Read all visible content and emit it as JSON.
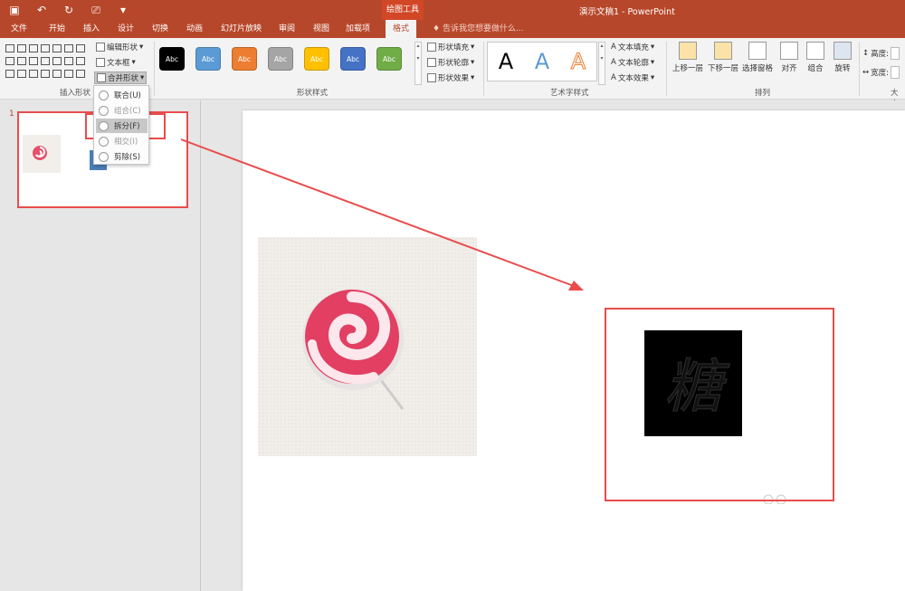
{
  "window": {
    "title": "演示文稿1 - PowerPoint",
    "context_tab_label": "绘图工具"
  },
  "quick_access": {
    "save_icon": "save-icon",
    "undo_icon": "undo-icon",
    "redo_icon": "redo-icon",
    "present_icon": "present-icon",
    "customize_icon": "customize-icon"
  },
  "tabs": [
    {
      "label": "文件"
    },
    {
      "label": "开始"
    },
    {
      "label": "插入"
    },
    {
      "label": "设计"
    },
    {
      "label": "切换"
    },
    {
      "label": "动画"
    },
    {
      "label": "幻灯片放映"
    },
    {
      "label": "审阅"
    },
    {
      "label": "视图"
    },
    {
      "label": "加载项"
    },
    {
      "label": "格式"
    }
  ],
  "tell_me": "告诉我您想要做什么...",
  "ribbon": {
    "insert_shapes": {
      "label": "插入形状",
      "edit_shape": "编辑形状",
      "text_box": "文本框",
      "merge_shapes": "合并形状"
    },
    "shape_styles": {
      "label": "形状样式",
      "swatches": [
        {
          "text": "Abc",
          "color": "#000000"
        },
        {
          "text": "Abc",
          "color": "#5b9bd5"
        },
        {
          "text": "Abc",
          "color": "#ed7d31"
        },
        {
          "text": "Abc",
          "color": "#a5a5a5"
        },
        {
          "text": "Abc",
          "color": "#ffc000"
        },
        {
          "text": "Abc",
          "color": "#4472c4"
        },
        {
          "text": "Abc",
          "color": "#70ad47"
        }
      ],
      "fill": "形状填充",
      "outline": "形状轮廓",
      "effects": "形状效果"
    },
    "wordart": {
      "label": "艺术字样式",
      "samples": [
        {
          "text": "A",
          "color": "#000000"
        },
        {
          "text": "A",
          "color": "#5b9bd5"
        },
        {
          "text": "A",
          "color": "#f4b183"
        }
      ],
      "text_fill": "文本填充",
      "text_outline": "文本轮廓",
      "text_effects": "文本效果"
    },
    "arrange": {
      "label": "排列",
      "bring_forward": "上移一层",
      "send_backward": "下移一层",
      "selection_pane": "选择窗格",
      "align": "对齐",
      "group": "组合",
      "rotate": "旋转"
    },
    "size": {
      "label": "大小",
      "height": "高度:",
      "width": "宽度:"
    }
  },
  "merge_menu": [
    {
      "label": "联合(U)"
    },
    {
      "label": "组合(C)"
    },
    {
      "label": "拆分(F)"
    },
    {
      "label": "相交(I)"
    },
    {
      "label": "剪除(S)"
    }
  ],
  "thumbnail_pane": {
    "slide_number": "1"
  },
  "slide": {
    "character": "糖"
  },
  "annotation_color": "#e84c4c"
}
